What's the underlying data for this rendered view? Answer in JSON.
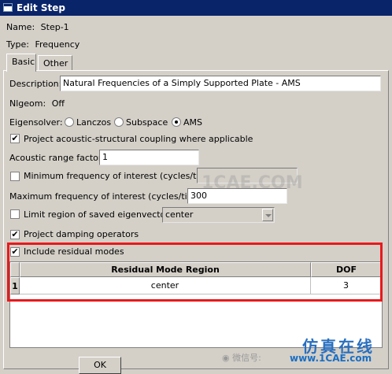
{
  "window": {
    "title": "Edit Step"
  },
  "header": {
    "name_label": "Name:",
    "name_value": "Step-1",
    "type_label": "Type:",
    "type_value": "Frequency"
  },
  "tabs": [
    {
      "label": "Basic",
      "active": true
    },
    {
      "label": "Other",
      "active": false
    }
  ],
  "basic": {
    "description_label": "Description:",
    "description_value": "Natural Frequencies of a Simply Supported Plate - AMS",
    "nlgeom_label": "Nlgeom:",
    "nlgeom_value": "Off",
    "eigensolver_label": "Eigensolver:",
    "eigensolver_options": [
      "Lanczos",
      "Subspace",
      "AMS"
    ],
    "eigensolver_selected": "AMS",
    "project_acoustic_label": "Project acoustic-structural coupling where applicable",
    "project_acoustic_checked": true,
    "acoustic_range_label": "Acoustic range factor:",
    "acoustic_range_value": "1",
    "min_freq_label": "Minimum frequency of interest (cycles/time):",
    "min_freq_checked": false,
    "min_freq_value": "",
    "max_freq_label": "Maximum frequency of interest (cycles/time):",
    "max_freq_value": "300",
    "limit_region_label": "Limit region of saved eigenvectors:",
    "limit_region_checked": false,
    "limit_region_value": "center",
    "project_damping_label": "Project damping operators",
    "project_damping_checked": true,
    "residual_modes_label": "Include residual modes",
    "residual_modes_checked": true,
    "residual_table": {
      "columns": [
        "Residual Mode Region",
        "DOF"
      ],
      "rows": [
        {
          "index": "1",
          "region": "center",
          "dof": "3"
        }
      ]
    }
  },
  "buttons": {
    "ok": "OK"
  },
  "watermark": {
    "text": "1CAE.COM",
    "brand_cn": "仿真在线",
    "brand_url": "www.1CAE.com",
    "wechat": "微信号:"
  },
  "colors": {
    "title_bar": "#0a246a",
    "highlight": "#e8191c",
    "dialog_bg": "#d4d0c8"
  }
}
